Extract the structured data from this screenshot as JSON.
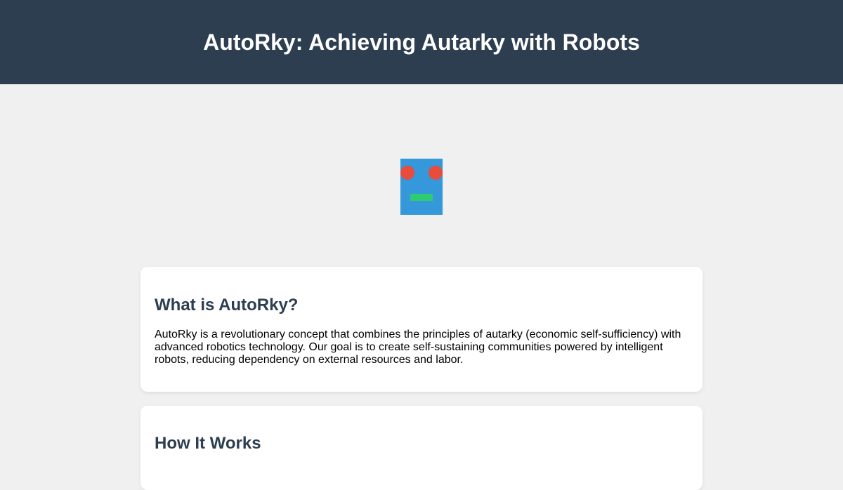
{
  "header": {
    "title": "AutoRky: Achieving Autarky with Robots"
  },
  "robot_logo": {
    "body_color": "#3498db",
    "eye_color": "#e74c3c",
    "mouth_color": "#2ecc71"
  },
  "sections": [
    {
      "heading": "What is AutoRky?",
      "body": "AutoRky is a revolutionary concept that combines the principles of autarky (economic self-sufficiency) with advanced robotics technology. Our goal is to create self-sustaining communities powered by intelligent robots, reducing dependency on external resources and labor."
    },
    {
      "heading": "How It Works"
    }
  ],
  "colors": {
    "header_bg": "#2c3e50",
    "page_bg": "#f0f0f0",
    "heading_text": "#2c3e50"
  }
}
